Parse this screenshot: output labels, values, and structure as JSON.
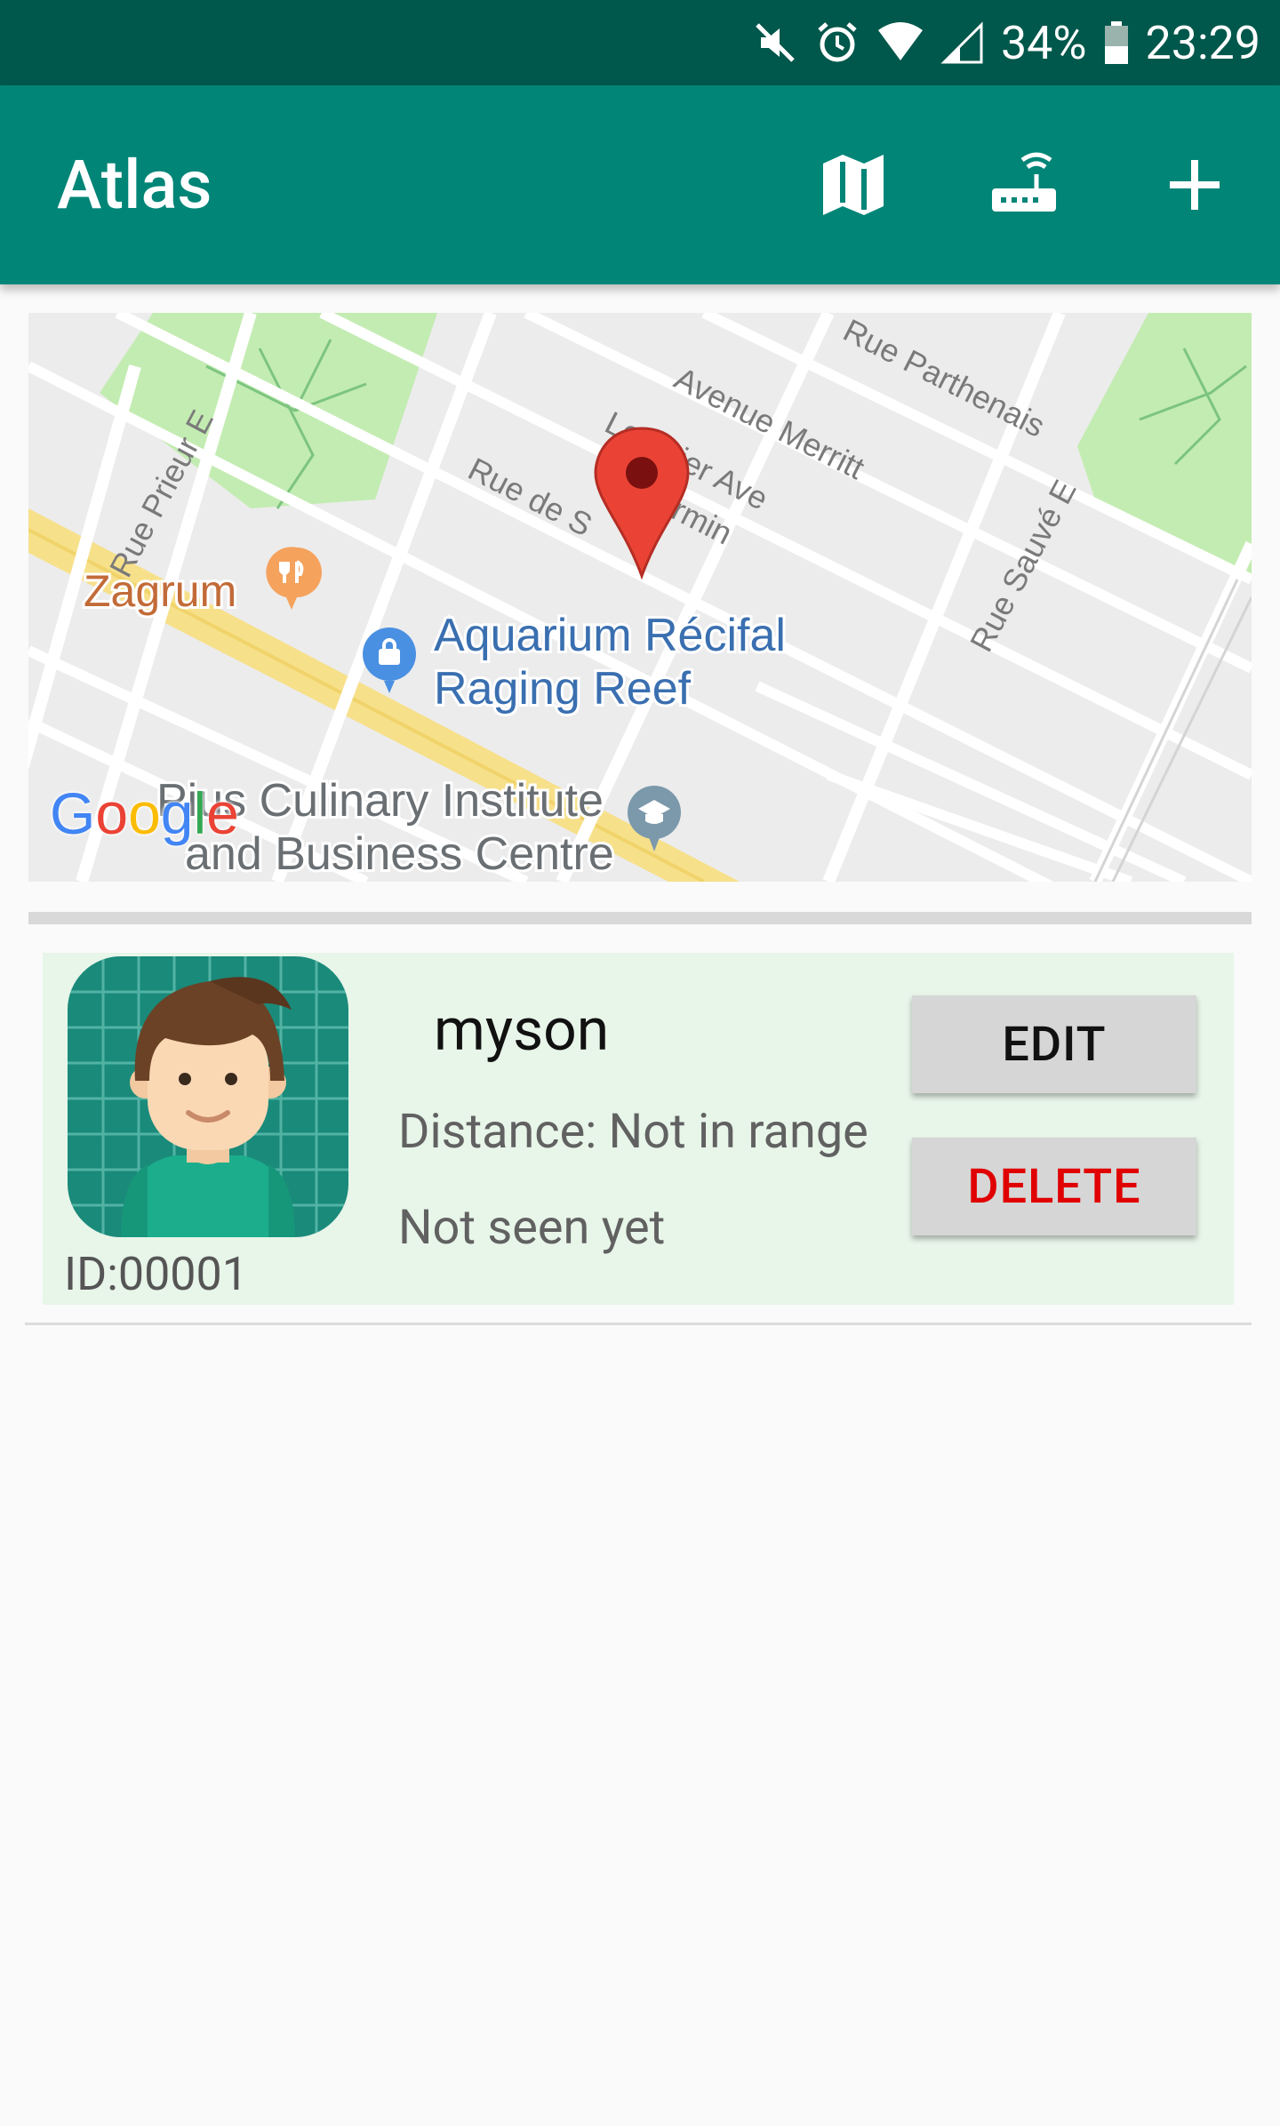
{
  "status_bar": {
    "battery": "34%",
    "time": "23:29",
    "icons": [
      "mute-icon",
      "alarm-icon",
      "wifi-icon",
      "signal-icon",
      "battery-icon"
    ]
  },
  "app_bar": {
    "title": "Atlas",
    "actions": [
      "map-icon",
      "router-icon",
      "add-icon"
    ]
  },
  "map": {
    "streets": [
      "Rue Parthenais",
      "Avenue Merritt",
      "Lorimier Ave",
      "Rue de S",
      "irmin",
      "Rue Prieur E",
      "Rue Sauvé E"
    ],
    "places": {
      "restaurant": "Zagrum",
      "aquarium_line1": "Aquarium Récifal",
      "aquarium_line2": "Raging Reef",
      "institute_line1": "Pius Culinary Institute",
      "institute_line2": "and Business Centre"
    },
    "logo": "Google"
  },
  "device_card": {
    "name": "myson",
    "distance": "Distance: Not in range",
    "seen": "Not seen yet",
    "id": "ID:00001",
    "edit_label": "EDIT",
    "delete_label": "DELETE"
  },
  "colors": {
    "status_bar": "#00574b",
    "app_bar": "#008577",
    "card_bg": "#e8f5e9",
    "delete_text": "#e00000",
    "pin": "#ea4335"
  }
}
